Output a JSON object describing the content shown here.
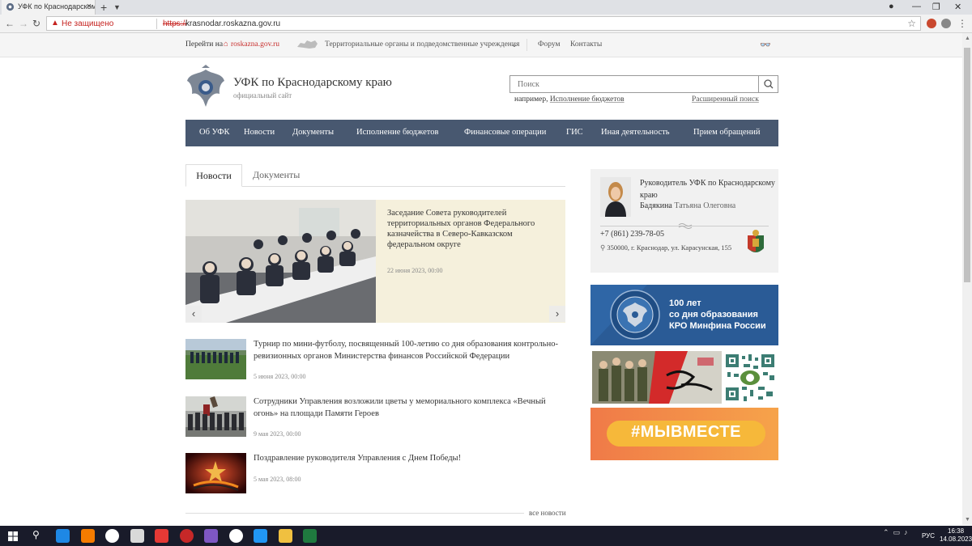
{
  "browser": {
    "tab_title": "УФК по Краснодарскому",
    "security_label": "Не защищено",
    "url_scheme": "https://",
    "url_host": "krasnodar.roskazna.gov.ru"
  },
  "topstrip": {
    "goto_label": "Перейти на",
    "roskazna_link": "roskazna.gov.ru",
    "territorial_label": "Территориальные органы и подведомственные учреждения",
    "forum": "Форум",
    "contacts": "Контакты"
  },
  "header": {
    "title": "УФК по Краснодарскому краю",
    "subtitle": "официальный сайт",
    "search_placeholder": "Поиск",
    "example_prefix": "например,",
    "example_link": "Исполнение бюджетов",
    "advanced_search": "Расширенный поиск"
  },
  "nav": [
    "Об УФК",
    "Новости",
    "Документы",
    "Исполнение бюджетов",
    "Финансовые операции",
    "ГИС",
    "Иная деятельность",
    "Прием обращений"
  ],
  "tabs": {
    "news": "Новости",
    "docs": "Документы"
  },
  "featured": {
    "title": "Заседание Совета руководителей территориальных органов Федерального казначейства в Северо-Кавказском федеральном округе",
    "date": "22 июня 2023, 00:00"
  },
  "news": [
    {
      "title": "Турнир по мини-футболу, посвященный 100-летию со дня образования контрольно-ревизионных органов Министерства финансов Российской Федерации",
      "date": "5 июня 2023, 00:00"
    },
    {
      "title": "Сотрудники Управления возложили цветы у мемориального комплекса «Вечный огонь» на площади Памяти Героев",
      "date": "9 мая 2023, 00:00"
    },
    {
      "title": "Поздравление руководителя Управления с Днем Победы!",
      "date": "5 мая 2023, 08:00"
    }
  ],
  "all_news": "все новости",
  "contact": {
    "role": "Руководитель УФК по Краснодарскому краю",
    "surname": "Бадякина",
    "firstname": "Татьяна Олеговна",
    "phone": "+7 (861) 239-78-05",
    "address": "350000, г. Краснодар, ул. Карасунская, 155"
  },
  "banner1": {
    "line1": "100 лет",
    "line2": "со дня образования",
    "line3": "КРО Минфина России"
  },
  "banner3": {
    "text": "#МЫВМЕСТЕ"
  },
  "taskbar": {
    "lang": "РУС",
    "time": "16:38",
    "date": "14.08.2023"
  }
}
